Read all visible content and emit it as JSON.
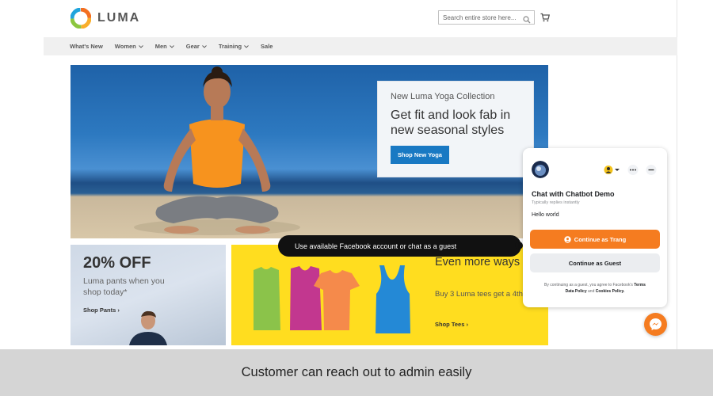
{
  "header": {
    "logo_text": "LUMA",
    "search_placeholder": "Search entire store here...",
    "icons": [
      "luma-logo-icon",
      "search-icon",
      "cart-icon"
    ]
  },
  "nav": {
    "items": [
      {
        "label": "What's New",
        "dropdown": false
      },
      {
        "label": "Women",
        "dropdown": true
      },
      {
        "label": "Men",
        "dropdown": true
      },
      {
        "label": "Gear",
        "dropdown": true
      },
      {
        "label": "Training",
        "dropdown": true
      },
      {
        "label": "Sale",
        "dropdown": false
      }
    ]
  },
  "hero": {
    "subtitle": "New Luma Yoga Collection",
    "title": "Get fit and look fab in new seasonal styles",
    "button": "Shop New Yoga"
  },
  "promo_pants": {
    "title": "20% OFF",
    "subtitle": "Luma pants when you shop today*",
    "link": "Shop Pants ›"
  },
  "promo_tees": {
    "title": "Even more ways to mix and match",
    "subtitle": "Buy 3 Luma tees get a 4th free",
    "link": "Shop Tees ›",
    "tee_colors": [
      "#8bc34a",
      "#c2378f",
      "#f58a4b",
      "#2489d6"
    ]
  },
  "tooltip": {
    "text": "Use available Facebook account or chat as a guest"
  },
  "chat": {
    "name": "Chat with Chatbot Demo",
    "status": "Typically replies instantly",
    "message": "Hello world",
    "primary_button": "Continue as Trang",
    "secondary_button": "Continue as Guest",
    "legal_prefix": "By continuing as a guest, you agree to Facebook's",
    "legal_terms": "Terms",
    "legal_data_policy": "Data Policy",
    "legal_and": "and",
    "legal_cookies": "Cookies Policy.",
    "accent_color": "#f57c20"
  },
  "caption": "Customer can reach out to admin easily"
}
